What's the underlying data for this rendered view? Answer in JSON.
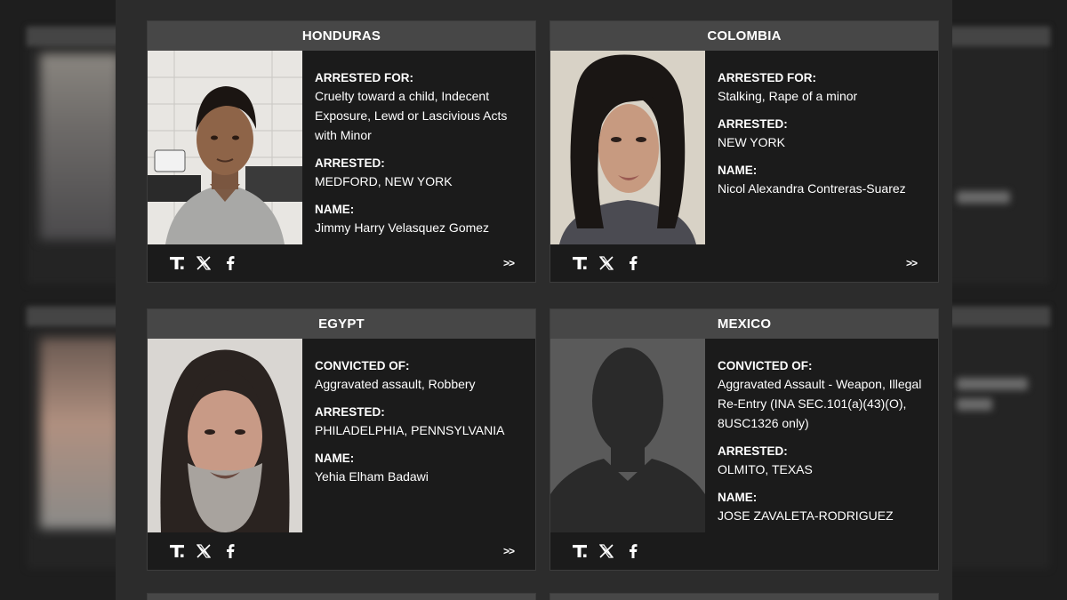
{
  "cards": [
    {
      "country": "HONDURAS",
      "fields": [
        {
          "label": "ARRESTED FOR:",
          "value": "Cruelty toward a child, Indecent Exposure, Lewd or Lascivious Acts with Minor"
        },
        {
          "label": "ARRESTED:",
          "value": "MEDFORD, NEW YORK"
        },
        {
          "label": "NAME:",
          "value": "Jimmy Harry Velasquez Gomez"
        }
      ],
      "more_label": ">>"
    },
    {
      "country": "COLOMBIA",
      "fields": [
        {
          "label": "ARRESTED FOR:",
          "value": "Stalking, Rape of a minor"
        },
        {
          "label": "ARRESTED:",
          "value": "NEW YORK"
        },
        {
          "label": "NAME:",
          "value": "Nicol Alexandra Contreras-Suarez"
        }
      ],
      "more_label": ">>"
    },
    {
      "country": "EGYPT",
      "fields": [
        {
          "label": "CONVICTED OF:",
          "value": "Aggravated assault, Robbery"
        },
        {
          "label": "ARRESTED:",
          "value": "PHILADELPHIA, PENNSYLVANIA"
        },
        {
          "label": "NAME:",
          "value": "Yehia Elham Badawi"
        }
      ],
      "more_label": ">>"
    },
    {
      "country": "MEXICO",
      "fields": [
        {
          "label": "CONVICTED OF:",
          "value": "Aggravated Assault - Weapon, Illegal Re-Entry (INA SEC.101(a)(43)(O), 8USC1326 only)"
        },
        {
          "label": "ARRESTED:",
          "value": "OLMITO, TEXAS"
        },
        {
          "label": "NAME:",
          "value": "JOSE ZAVALETA-RODRIGUEZ"
        }
      ]
    }
  ],
  "share_icons": [
    "truth-social-icon",
    "x-icon",
    "facebook-icon"
  ],
  "colors": {
    "page_bg": "#2c2c2c",
    "card_bg": "#1b1b1b",
    "card_header_bg": "#474747",
    "text": "#ffffff"
  }
}
